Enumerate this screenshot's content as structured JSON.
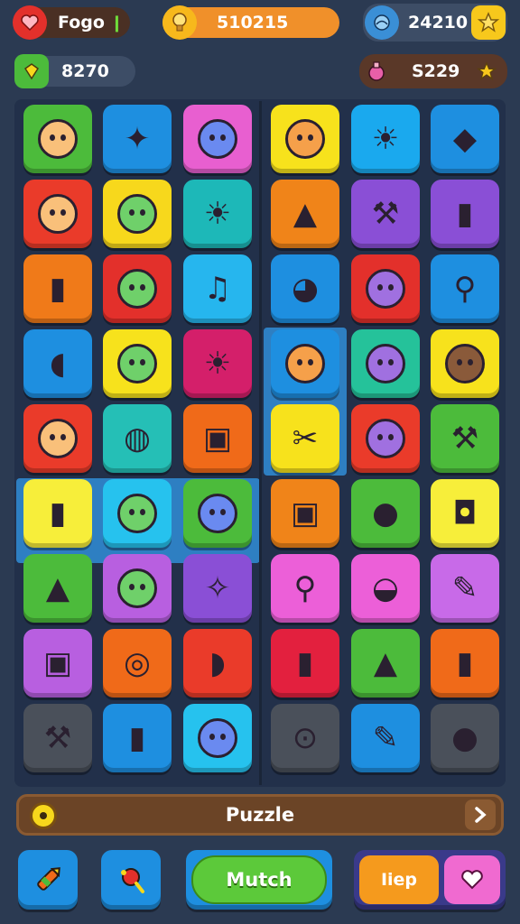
{
  "hud": {
    "player_name": "Fogo",
    "score": "510215",
    "coins": "24210",
    "gems": "8270",
    "stars": "S229"
  },
  "icons": {
    "player": "heart-icon",
    "score": "bulb-icon",
    "coins": "globe-icon",
    "coins_action": "star-icon",
    "gems": "gem-icon",
    "stars": "potion-icon",
    "stars_action": "star-icon"
  },
  "grid": {
    "rows": 9,
    "cols": 6,
    "tiles": [
      {
        "color": "#4cbb3b",
        "icon": "green-monster-icon"
      },
      {
        "color": "#1e8fe0",
        "icon": "carrot-icon"
      },
      {
        "color": "#e85fd0",
        "icon": "girl-face-icon"
      },
      {
        "color": "#f7e21c",
        "icon": "blue-monster-icon"
      },
      {
        "color": "#1aa9ee",
        "icon": "sun-icon"
      },
      {
        "color": "#1e8fe0",
        "icon": "tag-icon"
      },
      {
        "color": "#ea3b2a",
        "icon": "blue-fish-icon"
      },
      {
        "color": "#f7d81c",
        "icon": "cat-face-icon"
      },
      {
        "color": "#1db8b8",
        "icon": "sunflower-icon"
      },
      {
        "color": "#f08419",
        "icon": "bell-icon"
      },
      {
        "color": "#8a4fd6",
        "icon": "wrench-icon"
      },
      {
        "color": "#8a4fd6",
        "icon": "bottle-icon"
      },
      {
        "color": "#f07a19",
        "icon": "brush-icon"
      },
      {
        "color": "#e3302b",
        "icon": "bear-face-icon"
      },
      {
        "color": "#26b6ee",
        "icon": "music-note-icon"
      },
      {
        "color": "#1e8fe0",
        "icon": "acorn-icon"
      },
      {
        "color": "#e3302b",
        "icon": "boy-face-icon"
      },
      {
        "color": "#1e8fe0",
        "icon": "spoon-icon"
      },
      {
        "color": "#1e8fe0",
        "icon": "pig-car-icon"
      },
      {
        "color": "#f7e21c",
        "icon": "green-face-icon"
      },
      {
        "color": "#d41f6a",
        "icon": "sun-flower-icon"
      },
      {
        "color": "#1e8fe0",
        "icon": "bear-face-icon"
      },
      {
        "color": "#25c29a",
        "icon": "apple-face-icon"
      },
      {
        "color": "#f7e21c",
        "icon": "brown-bear-icon"
      },
      {
        "color": "#ea3b2a",
        "icon": "girl-face-icon"
      },
      {
        "color": "#25bfb6",
        "icon": "ice-cream-icon"
      },
      {
        "color": "#f06a19",
        "icon": "robot-icon"
      },
      {
        "color": "#f7e21c",
        "icon": "scissors-icon"
      },
      {
        "color": "#ea3b2a",
        "icon": "purple-monster-icon"
      },
      {
        "color": "#4cbb3b",
        "icon": "tools-icon"
      },
      {
        "color": "#f7ee3a",
        "icon": "marker-icon"
      },
      {
        "color": "#26c2ee",
        "icon": "kid-face-icon"
      },
      {
        "color": "#4cbb3b",
        "icon": "cookie-face-icon"
      },
      {
        "color": "#f08419",
        "icon": "truck-icon"
      },
      {
        "color": "#4cbb3b",
        "icon": "balloon-icon"
      },
      {
        "color": "#f7ee3a",
        "icon": "stroller-icon"
      },
      {
        "color": "#4cbb3b",
        "icon": "pyramid-icon"
      },
      {
        "color": "#b85fe0",
        "icon": "girl-face-icon"
      },
      {
        "color": "#8a4fd6",
        "icon": "feather-icon"
      },
      {
        "color": "#ec5fd8",
        "icon": "rattle-icon"
      },
      {
        "color": "#ec5fd8",
        "icon": "pot-icon"
      },
      {
        "color": "#c86ae8",
        "icon": "pencil-icon"
      },
      {
        "color": "#b85fe0",
        "icon": "bus-icon"
      },
      {
        "color": "#f06a19",
        "icon": "target-icon"
      },
      {
        "color": "#ea3b2a",
        "icon": "eggplant-icon"
      },
      {
        "color": "#e3203e",
        "icon": "tube-icon"
      },
      {
        "color": "#4cbb3b",
        "icon": "bell-icon"
      },
      {
        "color": "#f06a19",
        "icon": "crayon-icon"
      },
      {
        "color": "#4a505a",
        "icon": "wrench-icon"
      },
      {
        "color": "#1e8fe0",
        "icon": "glue-icon"
      },
      {
        "color": "#26c2ee",
        "icon": "green-face-icon"
      },
      {
        "color": "#4a505a",
        "icon": "magnifier-icon"
      },
      {
        "color": "#1e8fe0",
        "icon": "pencil-icon"
      },
      {
        "color": "#4a505a",
        "icon": "ball-icon"
      }
    ]
  },
  "puzzle_bar": {
    "label": "Puzzle",
    "left_icon": "coin-icon",
    "right_icon": "chevron-right-icon"
  },
  "bottom": {
    "left_icon": "crayon-icon",
    "middle_icon": "candy-icon",
    "match_label": "Mutch",
    "help_label": "Iiep",
    "heart_icon": "heart-icon"
  },
  "colors": {
    "background": "#2b3a52",
    "highlight": "#2e7fc2",
    "match_button": "#5cc93a",
    "help_button": "#f59a1d",
    "heart_button": "#f06ad0"
  }
}
